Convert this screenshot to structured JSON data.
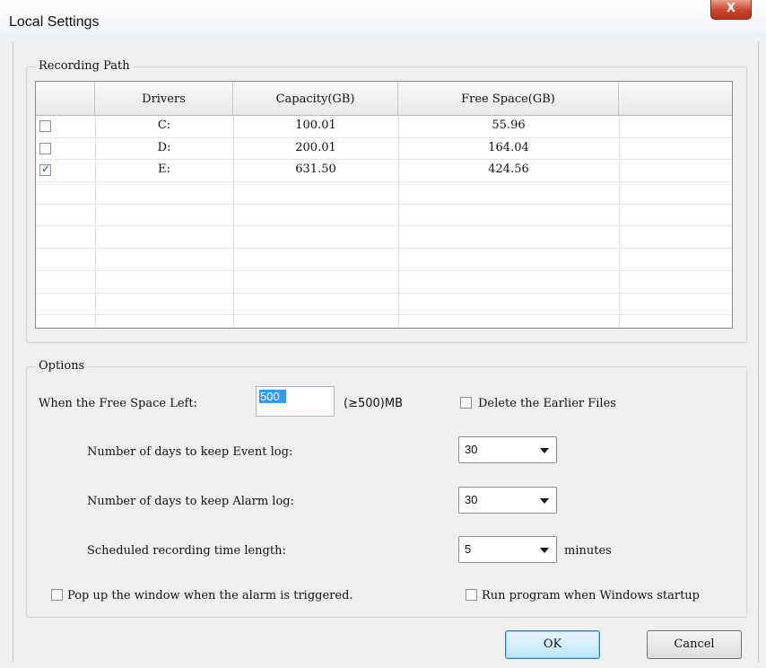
{
  "window": {
    "title": "Local Settings",
    "close_label": "X"
  },
  "recording_path": {
    "legend": "Recording Path",
    "columns": [
      "Drivers",
      "Capacity(GB)",
      "Free Space(GB)"
    ],
    "rows": [
      {
        "checked": false,
        "driver": "C:",
        "capacity": "100.01",
        "free": "55.96"
      },
      {
        "checked": false,
        "driver": "D:",
        "capacity": "200.01",
        "free": "164.04"
      },
      {
        "checked": true,
        "driver": "E:",
        "capacity": "631.50",
        "free": "424.56"
      }
    ]
  },
  "options": {
    "legend": "Options",
    "free_space_label": "When the Free Space Left:",
    "free_space_value": "500",
    "free_space_unit": "(≥500)MB",
    "delete_earlier_label": "Delete the Earlier Files",
    "delete_earlier_checked": false,
    "event_log_label": "Number of days to keep Event log:",
    "event_log_value": "30",
    "alarm_log_label": "Number of days to keep Alarm log:",
    "alarm_log_value": "30",
    "scheduled_label": "Scheduled recording time length:",
    "scheduled_value": "5",
    "scheduled_unit": "minutes",
    "popup_label": "Pop up the window when the alarm is triggered.",
    "popup_checked": false,
    "startup_label": "Run program when Windows startup",
    "startup_checked": false
  },
  "buttons": {
    "ok": "OK",
    "cancel": "Cancel"
  }
}
